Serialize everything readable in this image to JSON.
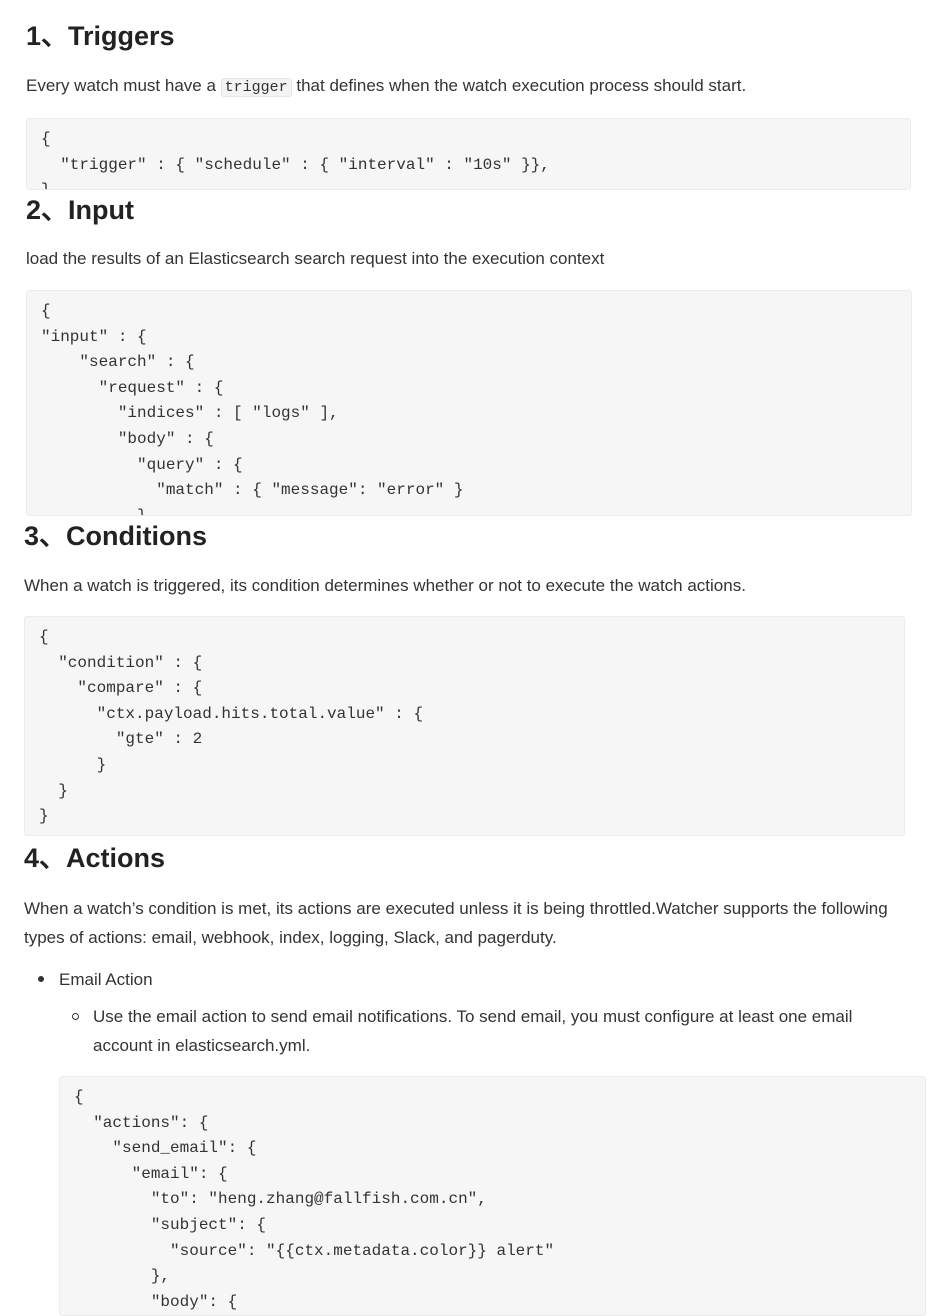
{
  "sections": [
    {
      "heading": "1、Triggers",
      "para_before": "Every watch must have a ",
      "inline_code": "trigger",
      "para_after": " that defines when the watch execution process should start.",
      "code": [
        "{",
        "  \"trigger\" : { \"schedule\" : { \"interval\" : \"10s\" }},",
        "}"
      ]
    },
    {
      "heading": "2、Input",
      "para": "load the results of an Elasticsearch search request into the execution context",
      "code": [
        "{",
        "\"input\" : {",
        "    \"search\" : {",
        "      \"request\" : {",
        "        \"indices\" : [ \"logs\" ],",
        "        \"body\" : {",
        "          \"query\" : {",
        "            \"match\" : { \"message\": \"error\" }",
        "          }"
      ]
    },
    {
      "heading": "3、Conditions",
      "para": "When a watch is triggered, its condition determines whether or not to execute the watch actions.",
      "code": [
        "{",
        "  \"condition\" : {",
        "    \"compare\" : {",
        "      \"ctx.payload.hits.total.value\" : {",
        "        \"gte\" : 2",
        "      }",
        "  }",
        "}"
      ]
    },
    {
      "heading": "4、Actions",
      "para": "When a watch’s condition is met, its actions are executed unless it is being throttled.Watcher supports the following types of actions: email, webhook, index, logging, Slack, and pagerduty.",
      "bullet": "Email Action",
      "sub_bullet": "Use the email action to send email notifications. To send email, you must configure at least one email account in elasticsearch.yml.",
      "code": [
        "{",
        "  \"actions\": {",
        "    \"send_email\": {",
        "      \"email\": {",
        "        \"to\": \"heng.zhang@fallfish.com.cn\",",
        "        \"subject\": {",
        "          \"source\": \"{{ctx.metadata.color}} alert\"",
        "        },",
        "        \"body\": {"
      ]
    }
  ]
}
